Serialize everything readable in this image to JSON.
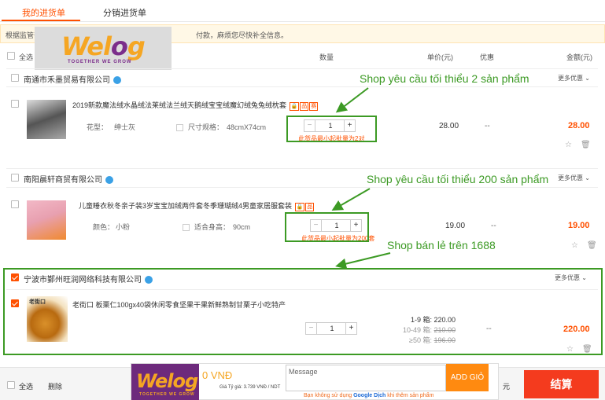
{
  "tabs": [
    {
      "label": "我的进货单",
      "active": true
    },
    {
      "label": "分销进货单",
      "active": false
    }
  ],
  "notice": {
    "text_start": "根据监管部",
    "text_end": "付款，麻烦您尽快补全信息。"
  },
  "overlay_logo": {
    "text_a": "We",
    "text_b": "l",
    "text_o": "o",
    "text_c": "g",
    "tagline": "TOGETHER WE GROW"
  },
  "table_header": {
    "select_all": "全选",
    "quantity": "数量",
    "unit_price": "单价(元)",
    "discount": "优惠",
    "amount": "金额(元)"
  },
  "more_discount_label": "更多优惠",
  "shops": [
    {
      "name": "南通市禾墨贸易有限公司",
      "checked": false,
      "item": {
        "title": "2019新款魔法绒水晶绒法莱绒法兰绒天鹅绒宝宝绒魔幻绒兔兔绒枕套",
        "tags": [
          "🔒",
          "品",
          "赛"
        ],
        "spec1_label": "花型：",
        "spec1_value": "绅士灰",
        "spec2_label": "尺寸规格：",
        "spec2_value": "48cmX74cm",
        "minus": "−",
        "plus": "+",
        "quantity": "1",
        "moq_warning": "此货品最小起批量为2对",
        "unit_price": "28.00",
        "discount": "--",
        "amount": "28.00"
      }
    },
    {
      "name": "南阳晨轩商贸有限公司",
      "checked": false,
      "item": {
        "title": "儿童睡衣秋冬亲子装3岁宝宝加绒两件套冬季珊瑚绒4男童家居服套装",
        "tags": [
          "🔒",
          "品"
        ],
        "spec1_label": "颜色：",
        "spec1_value": "小粉",
        "spec2_label": "适合身高：",
        "spec2_value": "90cm",
        "minus": "−",
        "plus": "+",
        "quantity": "1",
        "moq_warning": "此货品最小起批量为200套",
        "unit_price": "19.00",
        "discount": "--",
        "amount": "19.00"
      }
    },
    {
      "name": "宁波市鄞州旺润网络科技有限公司",
      "checked": true,
      "item": {
        "title": "老街口 板栗仁100gx40袋休闲零食坚果干果新鲜熟制甘栗子小吃特产",
        "thumb_label": "老街口",
        "minus": "−",
        "plus": "+",
        "quantity": "1",
        "tiers": [
          {
            "range": "1-9 箱:",
            "price": "220.00",
            "strike": false
          },
          {
            "range": "10-49 箱:",
            "price": "210.00",
            "strike": true
          },
          {
            "range": "≥50 箱:",
            "price": "196.00",
            "strike": true
          }
        ],
        "discount": "--",
        "amount": "220.00"
      }
    }
  ],
  "callouts": [
    "Shop yêu cầu tối thiểu 2 sản phẩm",
    "Shop yêu cầu tối thiểu 200 sản phẩm",
    "Shop bán lẻ trên 1688"
  ],
  "footer": {
    "select_all": "全选",
    "delete": "删除",
    "currency_fragment": "元",
    "checkout": "结算"
  },
  "extension": {
    "vnd_total": "0 VNĐ",
    "rate": "Giá Tỷ giá: 3.739 VNĐ / NDT",
    "message_placeholder": "Message",
    "add_button": "ADD GIỎ",
    "note_start": "Bạn không sử dụng ",
    "note_bold": "Google Dịch",
    "note_end": " khi thêm sản phẩm"
  },
  "colors": {
    "accent": "#ff5000",
    "callout_green": "#3c9a24",
    "checkout_red": "#f43b1e",
    "add_orange": "#ff8a10",
    "brand_purple": "#6d2a7c",
    "brand_gold": "#f5a623"
  }
}
